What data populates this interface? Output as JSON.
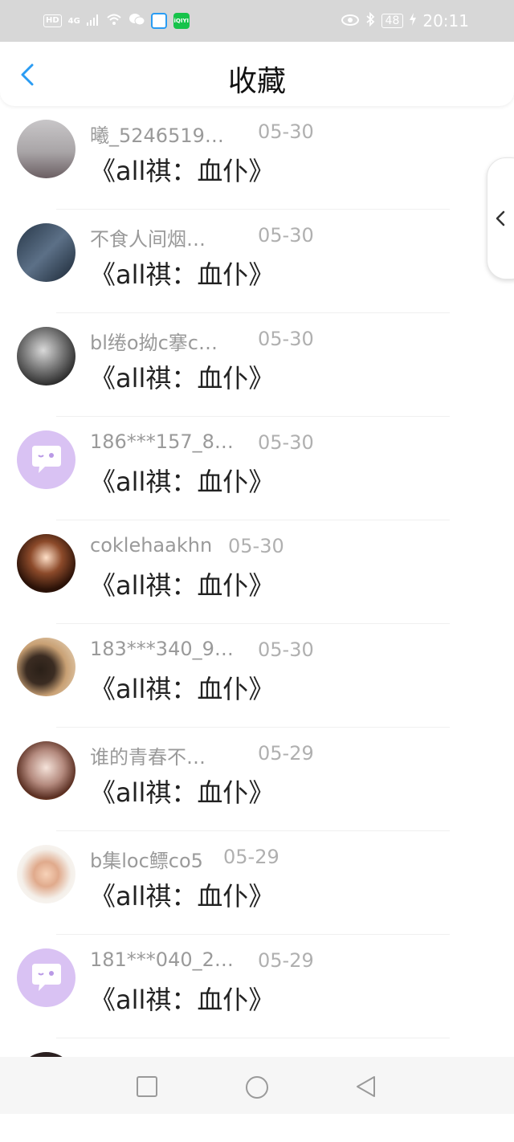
{
  "status_bar": {
    "network_type": "HD",
    "signal_label": "4G",
    "app_badge": "iQIYI",
    "battery": "48",
    "time": "20:11"
  },
  "header": {
    "title": "收藏",
    "back_icon": "chevron-left-icon"
  },
  "list": {
    "items": [
      {
        "name": "曦_5246519…",
        "date": "05-30",
        "book": "《all祺：血仆》",
        "avatar": "user-photo"
      },
      {
        "name": "不食人间烟…",
        "date": "05-30",
        "book": "《all祺：血仆》",
        "avatar": "user-photo"
      },
      {
        "name": "bl绻o拗c搴c…",
        "date": "05-30",
        "book": "《all祺：血仆》",
        "avatar": "user-photo"
      },
      {
        "name": "186***157_8…",
        "date": "05-30",
        "book": "《all祺：血仆》",
        "avatar": "default-chat-avatar"
      },
      {
        "name": "coklehaakhn",
        "date": "05-30",
        "book": "《all祺：血仆》",
        "avatar": "user-photo"
      },
      {
        "name": "183***340_9…",
        "date": "05-30",
        "book": "《all祺：血仆》",
        "avatar": "user-photo"
      },
      {
        "name": "谁的青春不…",
        "date": "05-29",
        "book": "《all祺：血仆》",
        "avatar": "user-photo"
      },
      {
        "name": "b集loc鳔co5",
        "date": "05-29",
        "book": "《all祺：血仆》",
        "avatar": "user-photo"
      },
      {
        "name": "181***040_2…",
        "date": "05-29",
        "book": "《all祺：血仆》",
        "avatar": "default-chat-avatar"
      }
    ]
  },
  "side_handle": {
    "icon": "chevron-left-icon"
  },
  "nav_bar": {
    "recent_icon": "square-icon",
    "home_icon": "circle-icon",
    "back_icon": "triangle-back-icon"
  },
  "colors": {
    "accent": "#2a9cf3",
    "default_avatar_bg": "#d9c2f3",
    "name_text": "#9a9a9a",
    "status_bar_bg": "#d7d7d7"
  }
}
